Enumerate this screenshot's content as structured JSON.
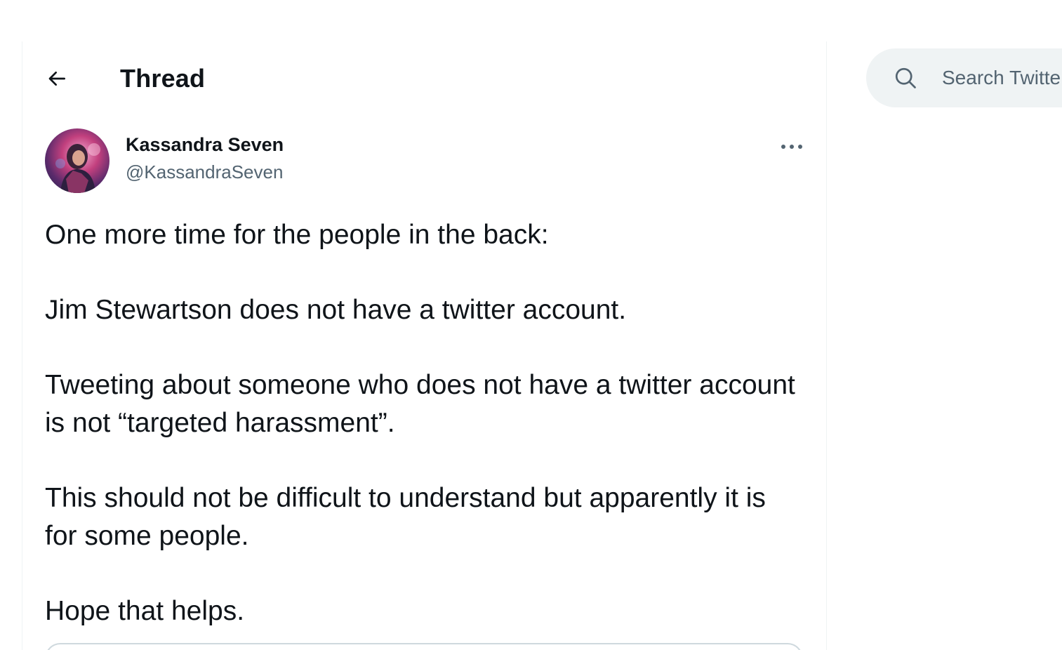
{
  "header": {
    "back_icon": "arrow-left-icon",
    "title": "Thread"
  },
  "tweet": {
    "author": {
      "name": "Kassandra Seven",
      "handle": "@KassandraSeven",
      "avatar": "profile-avatar"
    },
    "more_icon": "ellipsis-horizontal-icon",
    "paragraphs": [
      "One more time for the people in the back:",
      "Jim Stewartson does not have a twitter account.",
      "Tweeting about someone who does not have a twitter account is not “targeted harassment”.",
      "This should not be difficult to understand but apparently it is for some people.",
      "Hope that helps."
    ]
  },
  "search": {
    "icon": "search-icon",
    "placeholder": "Search Twitter"
  },
  "colors": {
    "text_primary": "#0f1419",
    "text_secondary": "#536471",
    "search_bg": "#eff3f4",
    "border": "#eff3f4"
  }
}
